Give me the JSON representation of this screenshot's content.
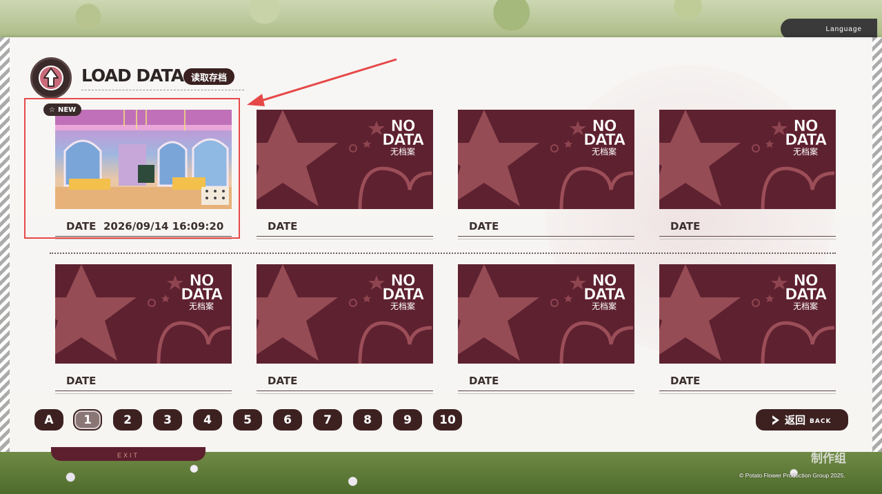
{
  "header": {
    "title": "LOAD DATA",
    "subtitle": "读取存档"
  },
  "background": {
    "language_label": "Language",
    "exit_label": "EXIT",
    "copyright": "© Potato Flower Production Group 2025.",
    "studio_logo_text": "制作组"
  },
  "slots": [
    {
      "badge": "NEW",
      "date_label": "DATE",
      "date": "2026/09/14 16:09:20",
      "has_data": true
    },
    {
      "date_label": "DATE",
      "no_data_line1": "NO",
      "no_data_line2": "DATA",
      "no_data_cn": "无档案",
      "has_data": false
    },
    {
      "date_label": "DATE",
      "no_data_line1": "NO",
      "no_data_line2": "DATA",
      "no_data_cn": "无档案",
      "has_data": false
    },
    {
      "date_label": "DATE",
      "no_data_line1": "NO",
      "no_data_line2": "DATA",
      "no_data_cn": "无档案",
      "has_data": false
    },
    {
      "date_label": "DATE",
      "no_data_line1": "NO",
      "no_data_line2": "DATA",
      "no_data_cn": "无档案",
      "has_data": false
    },
    {
      "date_label": "DATE",
      "no_data_line1": "NO",
      "no_data_line2": "DATA",
      "no_data_cn": "无档案",
      "has_data": false
    },
    {
      "date_label": "DATE",
      "no_data_line1": "NO",
      "no_data_line2": "DATA",
      "no_data_cn": "无档案",
      "has_data": false
    },
    {
      "date_label": "DATE",
      "no_data_line1": "NO",
      "no_data_line2": "DATA",
      "no_data_cn": "无档案",
      "has_data": false
    }
  ],
  "pager": {
    "pages": [
      "A",
      "1",
      "2",
      "3",
      "4",
      "5",
      "6",
      "7",
      "8",
      "9",
      "10"
    ],
    "active": "1"
  },
  "back": {
    "label_cn": "返回",
    "label_en": "BACK"
  },
  "colors": {
    "slot_bg": "#5e2130",
    "button_bg": "#3d2121",
    "highlight": "#e64848"
  }
}
